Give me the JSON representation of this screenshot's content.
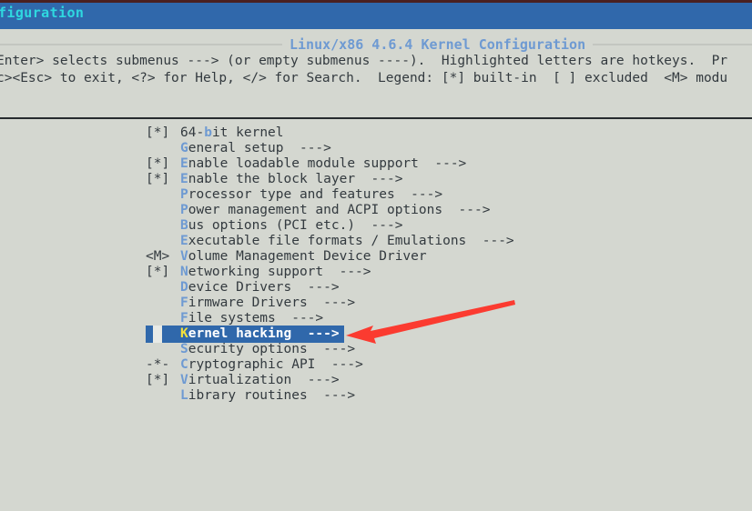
{
  "window": {
    "title_visible_text": "figuration",
    "title_full": "Linux/x86 4.6.4 Kernel Configuration",
    "titlebar_color": "#3068ab",
    "accent_color": "#2fd8e0"
  },
  "banner": {
    "label": "Linux/x86 4.6.4 Kernel Configuration"
  },
  "help": {
    "line1": "Enter> selects submenus ---> (or empty submenus ----).  Highlighted letters are hotkeys.  Pr",
    "line2": "c><Esc> to exit, <?> for Help, </> for Search.  Legend: [*] built-in  [ ] excluded  <M> modu"
  },
  "menu": {
    "items": [
      {
        "mark": "[*]",
        "hotkey": "b",
        "pre": "64-",
        "post": "it kernel",
        "arrow": "",
        "selected": false
      },
      {
        "mark": "",
        "hotkey": "G",
        "pre": "",
        "post": "eneral setup",
        "arrow": "  --->",
        "selected": false
      },
      {
        "mark": "[*]",
        "hotkey": "E",
        "pre": "",
        "post": "nable loadable module support",
        "arrow": "  --->",
        "selected": false
      },
      {
        "mark": "[*]",
        "hotkey": "E",
        "pre": "",
        "post": "nable the block layer",
        "arrow": "  --->",
        "selected": false
      },
      {
        "mark": "",
        "hotkey": "P",
        "pre": "",
        "post": "rocessor type and features",
        "arrow": "  --->",
        "selected": false
      },
      {
        "mark": "",
        "hotkey": "P",
        "pre": "",
        "post": "ower management and ACPI options",
        "arrow": "  --->",
        "selected": false
      },
      {
        "mark": "",
        "hotkey": "B",
        "pre": "",
        "post": "us options (PCI etc.)",
        "arrow": "  --->",
        "selected": false
      },
      {
        "mark": "",
        "hotkey": "E",
        "pre": "",
        "post": "xecutable file formats / Emulations",
        "arrow": "  --->",
        "selected": false
      },
      {
        "mark": "<M>",
        "hotkey": "V",
        "pre": "",
        "post": "olume Management Device Driver",
        "arrow": "",
        "selected": false
      },
      {
        "mark": "[*]",
        "hotkey": "N",
        "pre": "",
        "post": "etworking support",
        "arrow": "  --->",
        "selected": false
      },
      {
        "mark": "",
        "hotkey": "D",
        "pre": "",
        "post": "evice Drivers",
        "arrow": "  --->",
        "selected": false
      },
      {
        "mark": "",
        "hotkey": "F",
        "pre": "",
        "post": "irmware Drivers",
        "arrow": "  --->",
        "selected": false
      },
      {
        "mark": "",
        "hotkey": "F",
        "pre": "",
        "post": "ile systems",
        "arrow": "  --->",
        "selected": false
      },
      {
        "mark": "",
        "hotkey": "K",
        "pre": "",
        "post": "ernel hacking",
        "arrow": "  --->",
        "selected": true
      },
      {
        "mark": "",
        "hotkey": "S",
        "pre": "",
        "post": "ecurity options",
        "arrow": "  --->",
        "selected": false
      },
      {
        "mark": "-*-",
        "hotkey": "C",
        "pre": "",
        "post": "ryptographic API",
        "arrow": "  --->",
        "selected": false
      },
      {
        "mark": "[*]",
        "hotkey": "V",
        "pre": "",
        "post": "irtualization",
        "arrow": "  --->",
        "selected": false
      },
      {
        "mark": "",
        "hotkey": "L",
        "pre": "",
        "post": "ibrary routines",
        "arrow": "  --->",
        "selected": false
      }
    ]
  },
  "annotation": {
    "arrow_color": "#fb3b30",
    "points_to": "Kernel hacking"
  }
}
